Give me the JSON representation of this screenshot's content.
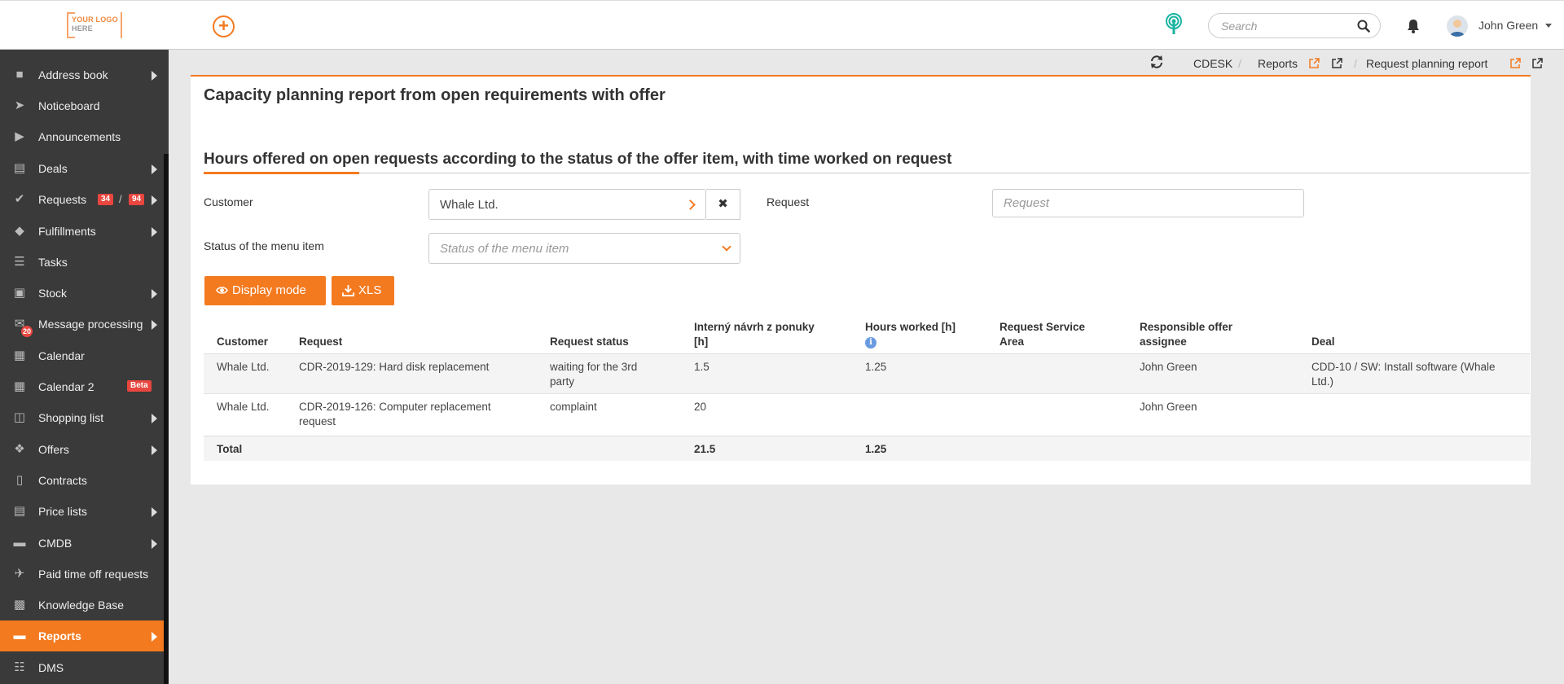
{
  "header": {
    "logo_line1": "YOUR LOGO",
    "logo_line2": "HERE",
    "search_placeholder": "Search",
    "user_name": "John Green"
  },
  "sidebar": {
    "items": [
      {
        "label": "Address book",
        "icon": "address-book-icon",
        "arrow": true
      },
      {
        "label": "Noticeboard",
        "icon": "paper-plane-icon",
        "arrow": false
      },
      {
        "label": "Announcements",
        "icon": "bullhorn-icon",
        "arrow": false
      },
      {
        "label": "Deals",
        "icon": "credit-card-icon",
        "arrow": true
      },
      {
        "label": "Requests",
        "icon": "check-circle-icon",
        "arrow": true,
        "badge1": "34",
        "badge_sep": "/",
        "badge2": "94"
      },
      {
        "label": "Fulfillments",
        "icon": "cube-icon",
        "arrow": true
      },
      {
        "label": "Tasks",
        "icon": "tasks-icon",
        "arrow": false
      },
      {
        "label": "Stock",
        "icon": "archive-icon",
        "arrow": true
      },
      {
        "label": "Message processing",
        "icon": "envelope-icon",
        "arrow": true,
        "count": "20"
      },
      {
        "label": "Calendar",
        "icon": "calendar-icon",
        "arrow": false
      },
      {
        "label": "Calendar 2",
        "icon": "calendar-icon",
        "arrow": false,
        "tag": "Beta"
      },
      {
        "label": "Shopping list",
        "icon": "cart-icon",
        "arrow": true
      },
      {
        "label": "Offers",
        "icon": "gift-icon",
        "arrow": true
      },
      {
        "label": "Contracts",
        "icon": "file-icon",
        "arrow": false
      },
      {
        "label": "Price lists",
        "icon": "file-text-icon",
        "arrow": true
      },
      {
        "label": "CMDB",
        "icon": "folder-open-icon",
        "arrow": true
      },
      {
        "label": "Paid time off requests",
        "icon": "plane-icon",
        "arrow": false
      },
      {
        "label": "Knowledge Base",
        "icon": "book-icon",
        "arrow": false
      },
      {
        "label": "Reports",
        "icon": "folder-open-icon",
        "arrow": true,
        "active": true
      },
      {
        "label": "DMS",
        "icon": "database-icon",
        "arrow": false
      }
    ]
  },
  "breadcrumb": {
    "items": [
      "CDESK",
      "Reports",
      "Request planning report"
    ],
    "separator": "/"
  },
  "page": {
    "title": "Capacity planning report from open requirements with offer",
    "section_title": "Hours offered on open requests according to the status of the offer item, with time worked on request"
  },
  "filters": {
    "customer_label": "Customer",
    "customer_value": "Whale Ltd.",
    "request_label": "Request",
    "request_placeholder": "Request",
    "status_label": "Status of the menu item",
    "status_placeholder": "Status of the menu item"
  },
  "buttons": {
    "display_mode": "Display mode",
    "xls": "XLS"
  },
  "table": {
    "headers": {
      "customer": "Customer",
      "request": "Request",
      "request_status": "Request status",
      "internal_l1": "Interný návrh z ponuky",
      "internal_l2": "[h]",
      "hours_worked": "Hours worked [h]",
      "service_area_l1": "Request Service",
      "service_area_l2": "Area",
      "assignee_l1": "Responsible offer",
      "assignee_l2": "assignee",
      "deal": "Deal"
    },
    "rows": [
      {
        "customer": "Whale Ltd.",
        "request_l1": "CDR-2019-129: Hard disk replacement",
        "request_l2": "",
        "status_l1": "waiting for the 3rd",
        "status_l2": "party",
        "internal": "1.5",
        "worked": "1.25",
        "service_area": "",
        "assignee": "John Green",
        "deal_l1": "CDD-10 / SW: Install software (Whale",
        "deal_l2": "Ltd.)"
      },
      {
        "customer": "Whale Ltd.",
        "request_l1": "CDR-2019-126: Computer replacement",
        "request_l2": "request",
        "status_l1": "complaint",
        "status_l2": "",
        "internal": "20",
        "worked": "",
        "service_area": "",
        "assignee": "John Green",
        "deal_l1": "",
        "deal_l2": ""
      }
    ],
    "total": {
      "label": "Total",
      "internal": "21.5",
      "worked": "1.25"
    }
  },
  "colors": {
    "accent": "#f47a20",
    "sidebar_bg": "#3a3a3a",
    "badge_red": "#e8463f"
  }
}
